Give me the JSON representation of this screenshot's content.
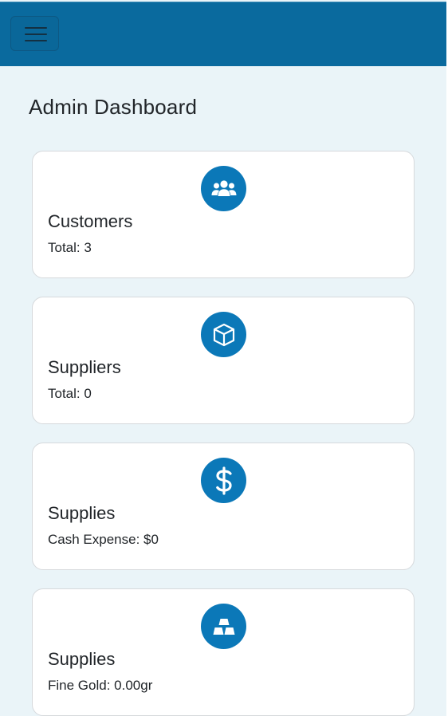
{
  "header": {
    "menu_icon": "hamburger-menu-icon"
  },
  "page": {
    "title": "Admin Dashboard"
  },
  "cards": [
    {
      "icon": "users-icon",
      "title": "Customers",
      "value": "Total: 3"
    },
    {
      "icon": "box-icon",
      "title": "Suppliers",
      "value": "Total: 0"
    },
    {
      "icon": "dollar-icon",
      "title": "Supplies",
      "value": "Cash Expense: $0"
    },
    {
      "icon": "gold-bars-icon",
      "title": "Supplies",
      "value": "Fine Gold: 0.00gr"
    }
  ],
  "colors": {
    "navbar": "#0a6a9e",
    "page_background": "#eaf4f8",
    "icon_circle": "#0b78b8",
    "card_background": "#ffffff"
  }
}
